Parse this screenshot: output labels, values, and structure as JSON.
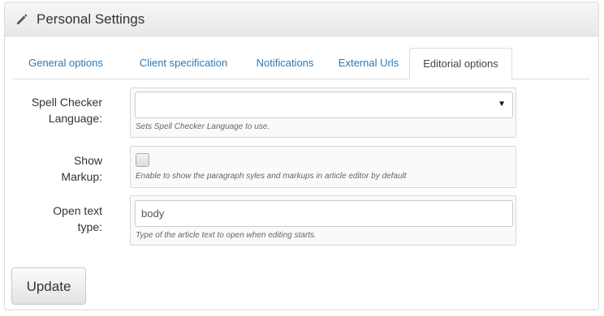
{
  "panel": {
    "title": "Personal Settings",
    "icon": "pencil-icon"
  },
  "tabs": [
    {
      "label": "General options",
      "active": false
    },
    {
      "label": "Client specification",
      "active": false
    },
    {
      "label": "Notifications",
      "active": false
    },
    {
      "label": "External Urls",
      "active": false
    },
    {
      "label": "Editorial options",
      "active": true
    }
  ],
  "fields": {
    "spell_checker": {
      "label_line1": "Spell Checker",
      "label_line2": "Language:",
      "value": "",
      "help": "Sets Spell Checker Language to use."
    },
    "show_markup": {
      "label_line1": "Show",
      "label_line2": "Markup:",
      "checked": false,
      "help": "Enable to show the paragraph syles and markups in article editor by default"
    },
    "open_text_type": {
      "label_line1": "Open text",
      "label_line2": "type:",
      "value": "body",
      "help": "Type of the article text to open when editing starts."
    }
  },
  "buttons": {
    "update_label": "Update"
  }
}
